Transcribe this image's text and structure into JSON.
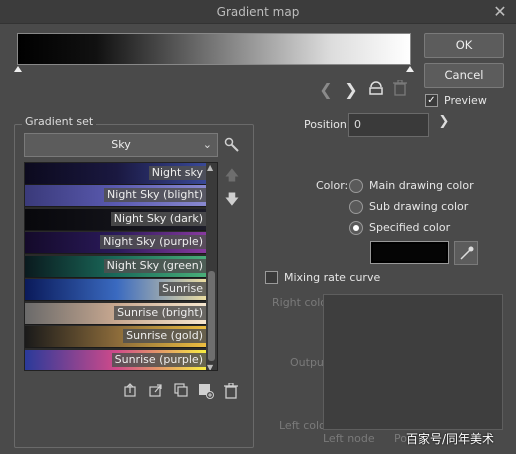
{
  "window": {
    "title": "Gradient map",
    "close_glyph": "✕"
  },
  "buttons": {
    "ok": "OK",
    "cancel": "Cancel"
  },
  "preview": {
    "label": "Preview",
    "checked": true
  },
  "position": {
    "label": "Position:",
    "value": "0"
  },
  "gradient_set": {
    "label": "Gradient set",
    "selected": "Sky",
    "items": [
      {
        "label": "Night sky",
        "colors": [
          "#0c0a1e",
          "#1a1840",
          "#3a4a9a"
        ]
      },
      {
        "label": "Night Sky (blight)",
        "colors": [
          "#3a3a7a",
          "#5a5ab0",
          "#8a8ad0"
        ]
      },
      {
        "label": "Night Sky (dark)",
        "colors": [
          "#08080c",
          "#121218",
          "#1e1e2a"
        ]
      },
      {
        "label": "Night Sky (purple)",
        "colors": [
          "#140a2a",
          "#2a1a5a",
          "#8a3aa0"
        ]
      },
      {
        "label": "Night Sky (green)",
        "colors": [
          "#0a1a1e",
          "#1a6a5a",
          "#4ab07a"
        ]
      },
      {
        "label": "Sunrise",
        "colors": [
          "#0a1a5a",
          "#3a6ac0",
          "#f0e0a0"
        ]
      },
      {
        "label": "Sunrise (bright)",
        "colors": [
          "#6a6a6a",
          "#c8a890",
          "#f8e8d0"
        ]
      },
      {
        "label": "Sunrise (gold)",
        "colors": [
          "#1a1a1a",
          "#8a6a3a",
          "#f0c040"
        ]
      },
      {
        "label": "Sunrise (purple)",
        "colors": [
          "#2a3a9a",
          "#d04a8a",
          "#f8f040"
        ]
      }
    ]
  },
  "color": {
    "label": "Color:",
    "options": [
      "Main drawing color",
      "Sub drawing color",
      "Specified color"
    ],
    "selected_index": 2,
    "specified_hex": "#000000"
  },
  "curve": {
    "label": "Mixing rate curve",
    "right_color": "Right color",
    "output": "Output",
    "left_color": "Left color",
    "left_node": "Left node",
    "right_node_partial": "Po"
  },
  "watermark": "百家号/同年美术"
}
